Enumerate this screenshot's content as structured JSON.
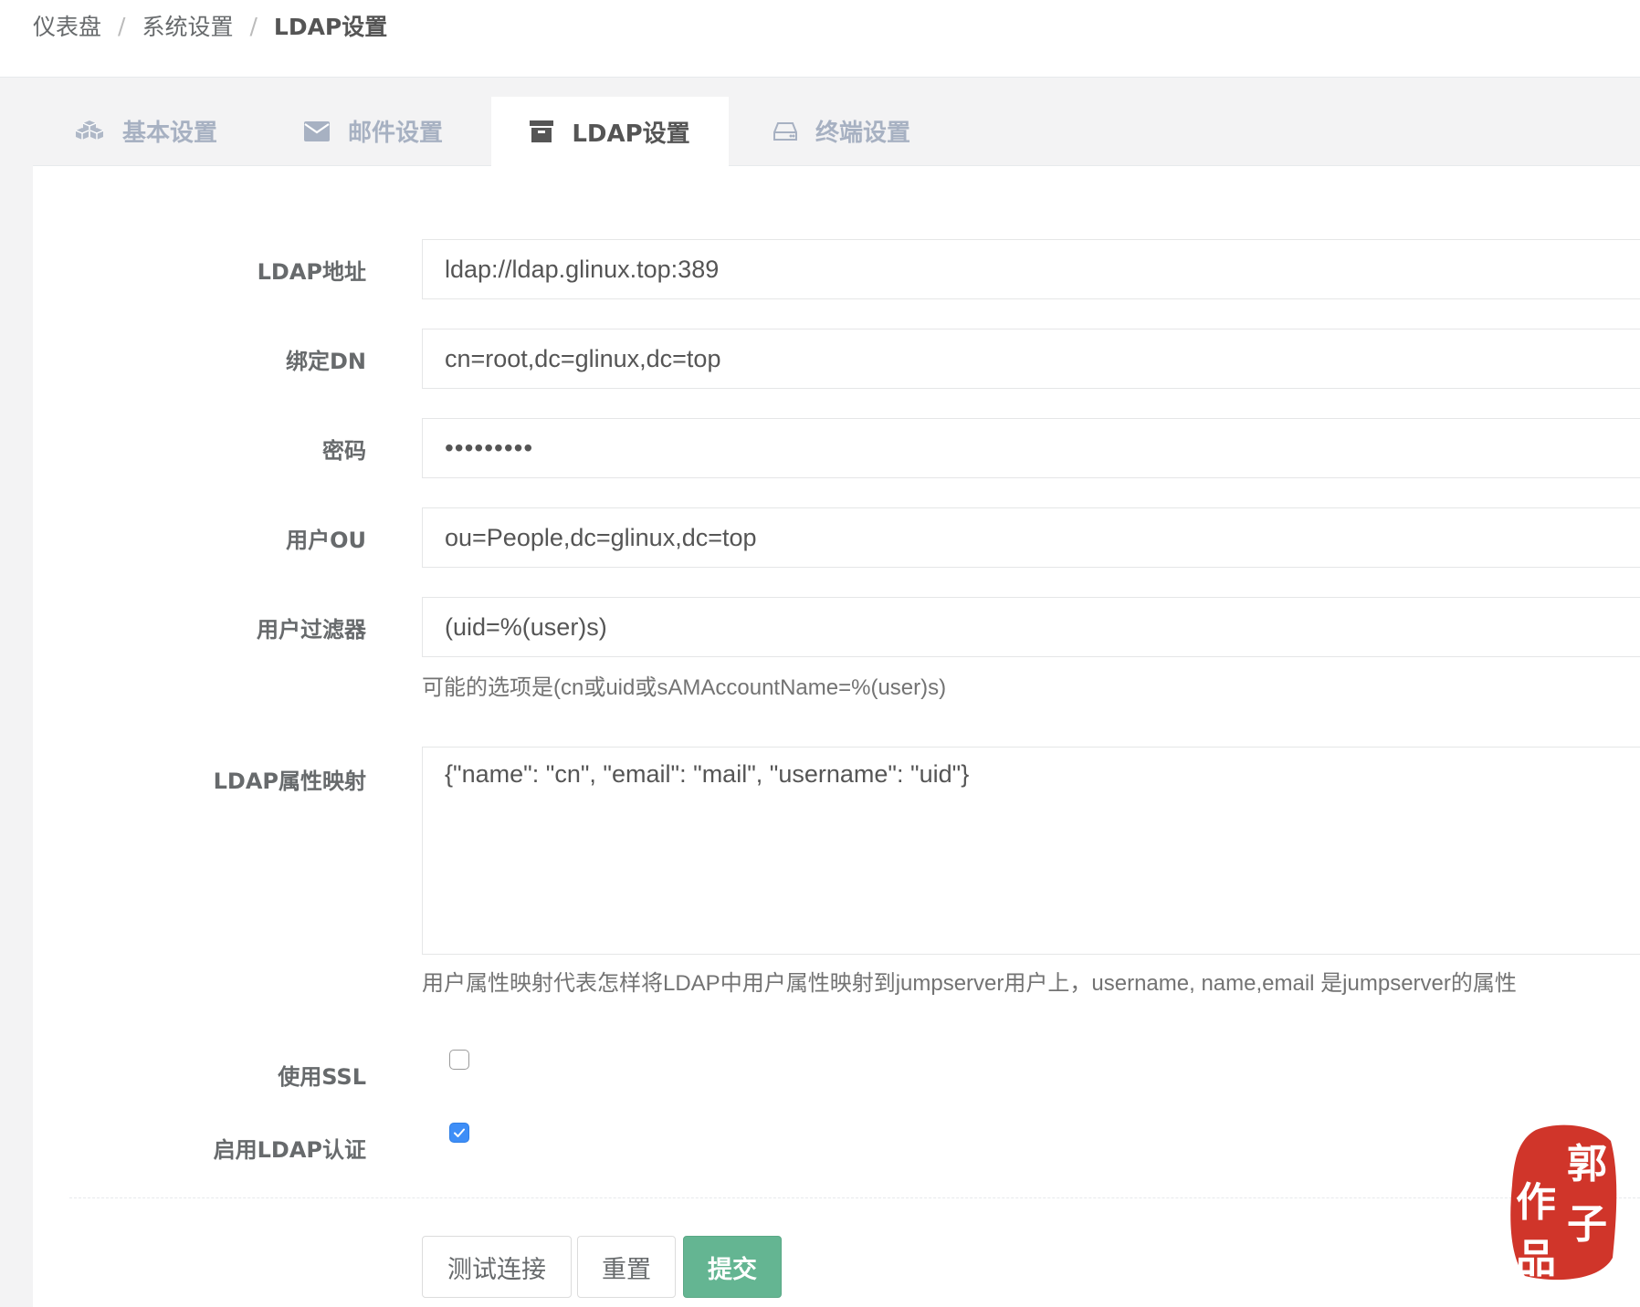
{
  "breadcrumb": {
    "items": [
      "仪表盘",
      "系统设置",
      "LDAP设置"
    ],
    "separator": "/"
  },
  "tabs": [
    {
      "label": "基本设置",
      "icon": "cubes-icon",
      "active": false
    },
    {
      "label": "邮件设置",
      "icon": "envelope-icon",
      "active": false
    },
    {
      "label": "LDAP设置",
      "icon": "archive-icon",
      "active": true
    },
    {
      "label": "终端设置",
      "icon": "hdd-icon",
      "active": false
    }
  ],
  "form": {
    "ldap_url": {
      "label": "LDAP地址",
      "value": "ldap://ldap.glinux.top:389"
    },
    "bind_dn": {
      "label": "绑定DN",
      "value": "cn=root,dc=glinux,dc=top"
    },
    "password": {
      "label": "密码",
      "value": "•••••••••"
    },
    "user_ou": {
      "label": "用户OU",
      "value": "ou=People,dc=glinux,dc=top"
    },
    "user_filter": {
      "label": "用户过滤器",
      "value": "(uid=%(user)s)",
      "help": "可能的选项是(cn或uid或sAMAccountName=%(user)s)"
    },
    "attr_map": {
      "label": "LDAP属性映射",
      "value": "{\"name\": \"cn\", \"email\": \"mail\", \"username\": \"uid\"}",
      "help": "用户属性映射代表怎样将LDAP中用户属性映射到jumpserver用户上，username, name,email 是jumpserver的属性"
    },
    "use_ssl": {
      "label": "使用SSL",
      "checked": false
    },
    "enable_auth": {
      "label": "启用LDAP认证",
      "checked": true
    }
  },
  "buttons": {
    "test": "测试连接",
    "reset": "重置",
    "submit": "提交"
  },
  "seal": {
    "text": "郭子作品",
    "color": "#d0352a"
  },
  "colors": {
    "primary_button": "#64b592",
    "checkbox_checked": "#3e8ef7"
  }
}
